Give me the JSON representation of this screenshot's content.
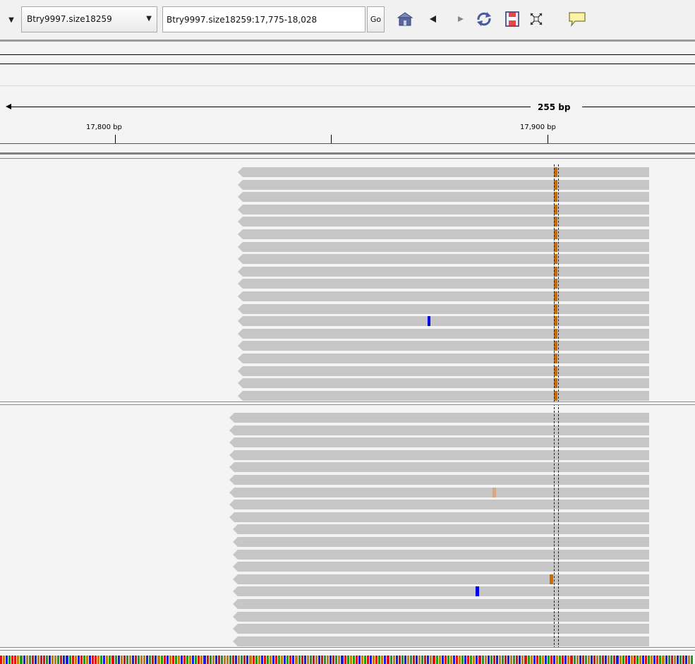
{
  "toolbar": {
    "chromosome": "Btry9997.size18259",
    "locus": "Btry9997.size18259:17,775-18,028",
    "go_label": "Go",
    "icons": [
      "home-icon",
      "back-icon",
      "forward-icon",
      "refresh-icon",
      "region-of-interest-icon",
      "resize-icon",
      "popup-text-icon"
    ]
  },
  "ruler": {
    "span_label": "255 bp",
    "ticks": [
      "17,800 bp",
      "17,900 bp"
    ]
  },
  "colors": {
    "read": "#c6c6c6",
    "mismatch_orange": "#cc6b00",
    "mismatch_blue": "#0000e0",
    "mismatch_tan": "#d4a88a",
    "base_A": "#1e9a1e",
    "base_C": "#1a1ae0",
    "base_G": "#c57a00",
    "base_T": "#e01010"
  },
  "sequence": "TGCATTGACGATCGTTACGGATCCATGCTAGCTTGACGATACGTAGCTAGGCATCGATCGTAGCTAGCATGCTAGCTAGGATCGATCGTAGCTAGCTAGCATCGATCGATGCTAGCTAGCTAGATCGATCGTAGCTAGCTACGATCGATCGTAGCTAGCTGACTAGCTAGCATCGATCGATCGTAGCTAGCATCGATCGTAGCTAGCTGATCGATCGATCGTAGCTAGCTAGCATGCATCGA"
}
